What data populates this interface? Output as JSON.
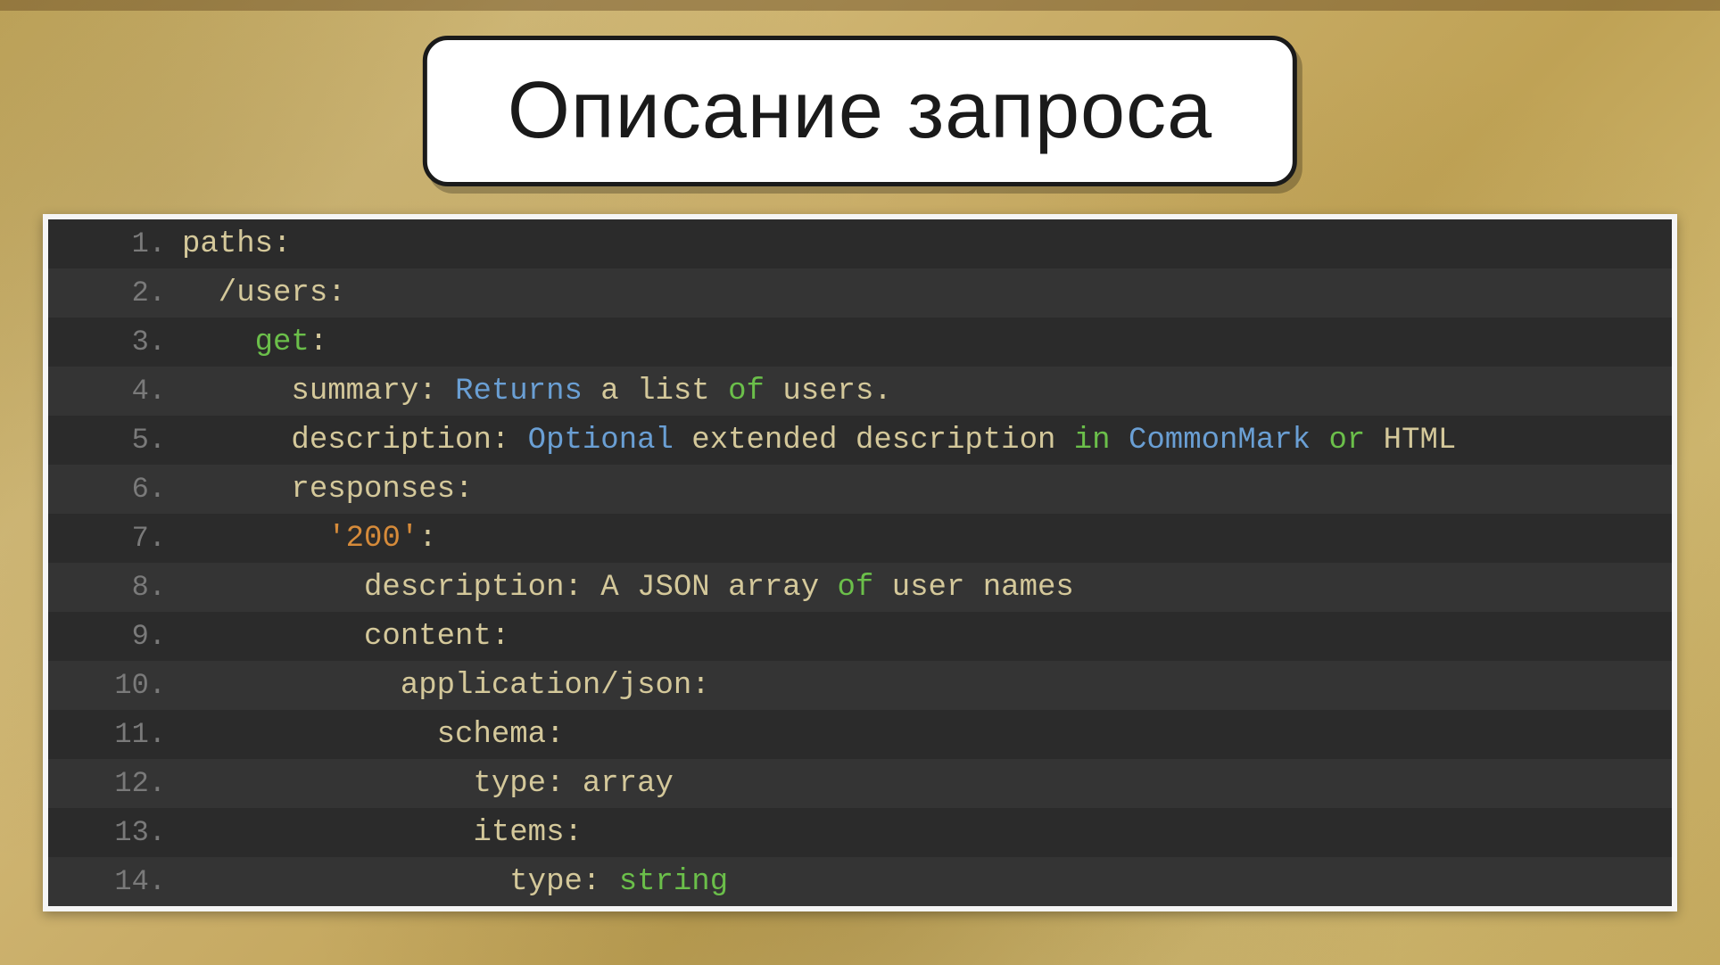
{
  "title": "Описание запроса",
  "code": {
    "lines": [
      {
        "n": "1.",
        "tokens": [
          {
            "t": "paths:",
            "c": "txt"
          }
        ]
      },
      {
        "n": "2.",
        "tokens": [
          {
            "t": "  /users:",
            "c": "txt"
          }
        ]
      },
      {
        "n": "3.",
        "tokens": [
          {
            "t": "    ",
            "c": "txt"
          },
          {
            "t": "get",
            "c": "kw-green"
          },
          {
            "t": ":",
            "c": "txt"
          }
        ]
      },
      {
        "n": "4.",
        "tokens": [
          {
            "t": "      summary: ",
            "c": "txt"
          },
          {
            "t": "Returns",
            "c": "kw-blue"
          },
          {
            "t": " a list ",
            "c": "txt"
          },
          {
            "t": "of",
            "c": "kw-green"
          },
          {
            "t": " users.",
            "c": "txt"
          }
        ]
      },
      {
        "n": "5.",
        "tokens": [
          {
            "t": "      description: ",
            "c": "txt"
          },
          {
            "t": "Optional",
            "c": "kw-blue"
          },
          {
            "t": " extended description ",
            "c": "txt"
          },
          {
            "t": "in",
            "c": "kw-green"
          },
          {
            "t": " ",
            "c": "txt"
          },
          {
            "t": "CommonMark",
            "c": "kw-blue"
          },
          {
            "t": " ",
            "c": "txt"
          },
          {
            "t": "or",
            "c": "kw-green"
          },
          {
            "t": " HTML",
            "c": "txt"
          }
        ]
      },
      {
        "n": "6.",
        "tokens": [
          {
            "t": "      responses:",
            "c": "txt"
          }
        ]
      },
      {
        "n": "7.",
        "tokens": [
          {
            "t": "        ",
            "c": "txt"
          },
          {
            "t": "'200'",
            "c": "kw-orange"
          },
          {
            "t": ":",
            "c": "txt"
          }
        ]
      },
      {
        "n": "8.",
        "tokens": [
          {
            "t": "          description: A JSON array ",
            "c": "txt"
          },
          {
            "t": "of",
            "c": "kw-green"
          },
          {
            "t": " user names",
            "c": "txt"
          }
        ]
      },
      {
        "n": "9.",
        "tokens": [
          {
            "t": "          content:",
            "c": "txt"
          }
        ]
      },
      {
        "n": "10.",
        "tokens": [
          {
            "t": "            application/json:",
            "c": "txt"
          }
        ]
      },
      {
        "n": "11.",
        "tokens": [
          {
            "t": "              schema:",
            "c": "txt"
          }
        ]
      },
      {
        "n": "12.",
        "tokens": [
          {
            "t": "                type: array",
            "c": "txt"
          }
        ]
      },
      {
        "n": "13.",
        "tokens": [
          {
            "t": "                items:",
            "c": "txt"
          }
        ]
      },
      {
        "n": "14.",
        "tokens": [
          {
            "t": "                  type: ",
            "c": "txt"
          },
          {
            "t": "string",
            "c": "kw-green"
          }
        ]
      }
    ]
  }
}
